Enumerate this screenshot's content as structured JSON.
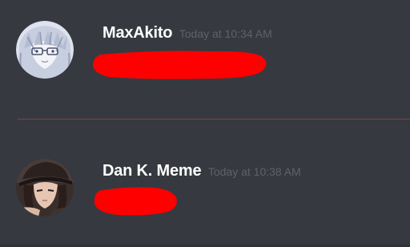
{
  "colors": {
    "background": "#36393f",
    "divider": "#85424a",
    "username": "#ffffff",
    "timestamp": "#5f6268",
    "redaction": "#ff0000"
  },
  "messages": [
    {
      "author": "MaxAkito",
      "timestamp": "Today at 10:34 AM",
      "avatar_icon": "anime-girl-avatar-icon",
      "content": "redacted"
    },
    {
      "author": "Dan K. Meme",
      "timestamp": "Today at 10:38 AM",
      "avatar_icon": "dark-haired-character-avatar-icon",
      "content": "redacted"
    }
  ]
}
